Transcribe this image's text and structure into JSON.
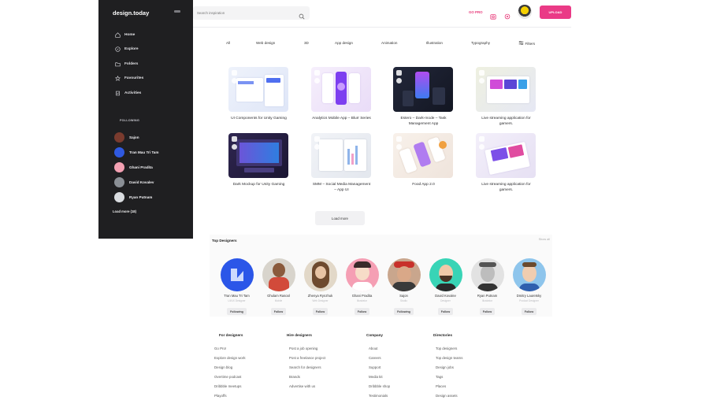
{
  "brand": "design.today",
  "nav": [
    {
      "label": "Home",
      "icon": "home-icon"
    },
    {
      "label": "Explore",
      "icon": "compass-icon"
    },
    {
      "label": "Folders",
      "icon": "folder-icon"
    },
    {
      "label": "Favourites",
      "icon": "star-icon"
    },
    {
      "label": "Activities",
      "icon": "activity-icon"
    }
  ],
  "following": {
    "title": "FOLLOWING",
    "items": [
      {
        "name": "Sajon",
        "color": "#7a3b2e"
      },
      {
        "name": "Tran Mau Tri Tam",
        "color": "#2f59e0"
      },
      {
        "name": "Ghani Pradita",
        "color": "#f3a0b2"
      },
      {
        "name": "David Kovalev",
        "color": "#8a8f95"
      },
      {
        "name": "Ryan Putnam",
        "color": "#d9dce0"
      }
    ],
    "load_more": "Load more (18)"
  },
  "search": {
    "placeholder": "Search inspiration"
  },
  "header": {
    "gopro": "GO PRO",
    "upload": "UPLOAD"
  },
  "filters": {
    "items": [
      "All",
      "Web design",
      "3D",
      "App design",
      "Animation",
      "Illustration",
      "Typography"
    ],
    "filters_label": "Filters"
  },
  "shots": [
    {
      "title": "UI Components for Unity Gaming",
      "bg": "#e9eef8",
      "accent": "#4f6ff0"
    },
    {
      "title": "Analytics Mobile App – Blurr Series",
      "bg": "#f3ecfb",
      "accent": "#9b5cf0"
    },
    {
      "title": "Estero – Dark-mode – Task Management App",
      "bg": "#1b1f2b",
      "accent": "#c95cf0"
    },
    {
      "title": "Live streaming application for gamers.",
      "bg": "#eef0e6",
      "accent": "#d04cd8"
    },
    {
      "title": "Dark Mockup for Unity Gaming",
      "bg": "#2a2342",
      "accent": "#6b55d8"
    },
    {
      "title": "SMM – Social Media Management – App UI",
      "bg": "#eef0f4",
      "accent": "#8fb4ea"
    },
    {
      "title": "Food App 2.0",
      "bg": "#f6f0ea",
      "accent": "#b07cf0"
    },
    {
      "title": "Live streaming application for gamers.",
      "bg": "#f0ecf8",
      "accent": "#7c4fe8"
    }
  ],
  "load_more": "Load more",
  "designers": {
    "title": "Top Designers",
    "show_all": "Show all",
    "items": [
      {
        "name": "Tran Mau Tri Tam",
        "role": "UI/UX Designer",
        "button": "Following",
        "bg": "#2b56e8"
      },
      {
        "name": "Ghulam Rasool",
        "role": "Mobile",
        "button": "Follow",
        "bg": "#d8d4cc"
      },
      {
        "name": "Zhenya Rynzhuk",
        "role": "Web Designer",
        "button": "Follow",
        "bg": "#e2d8c8"
      },
      {
        "name": "Ghani Pradita",
        "role": "Illustrator",
        "button": "Follow",
        "bg": "#f59fb4"
      },
      {
        "name": "Sajon",
        "role": "Studio",
        "button": "Following",
        "bg": "#c9a68d"
      },
      {
        "name": "David Kovalev",
        "role": "Designer",
        "button": "Follow",
        "bg": "#38d4b6"
      },
      {
        "name": "Ryan Putnam",
        "role": "Illustrator",
        "button": "Follow",
        "bg": "#e2e2e2"
      },
      {
        "name": "Dmitry Lauretsky",
        "role": "Product Designer",
        "button": "Follow",
        "bg": "#8ec5ec"
      }
    ]
  },
  "footer": [
    {
      "title": "For designers",
      "links": [
        "Go Pro!",
        "Explore design work",
        "Design blog",
        "Overtime podcast",
        "Dribbble meetups",
        "Playoffs"
      ]
    },
    {
      "title": "Hire designers",
      "links": [
        "Post a job opening",
        "Post a freelance project",
        "Search for designers",
        "Brands",
        "Advertise with us"
      ]
    },
    {
      "title": "Company",
      "links": [
        "About",
        "Careers",
        "Support",
        "Media kit",
        "Dribbble shop",
        "Testimonials"
      ]
    },
    {
      "title": "Directories",
      "links": [
        "Top designers",
        "Top design teams",
        "Design jobs",
        "Tags",
        "Places",
        "Design assets"
      ]
    }
  ]
}
